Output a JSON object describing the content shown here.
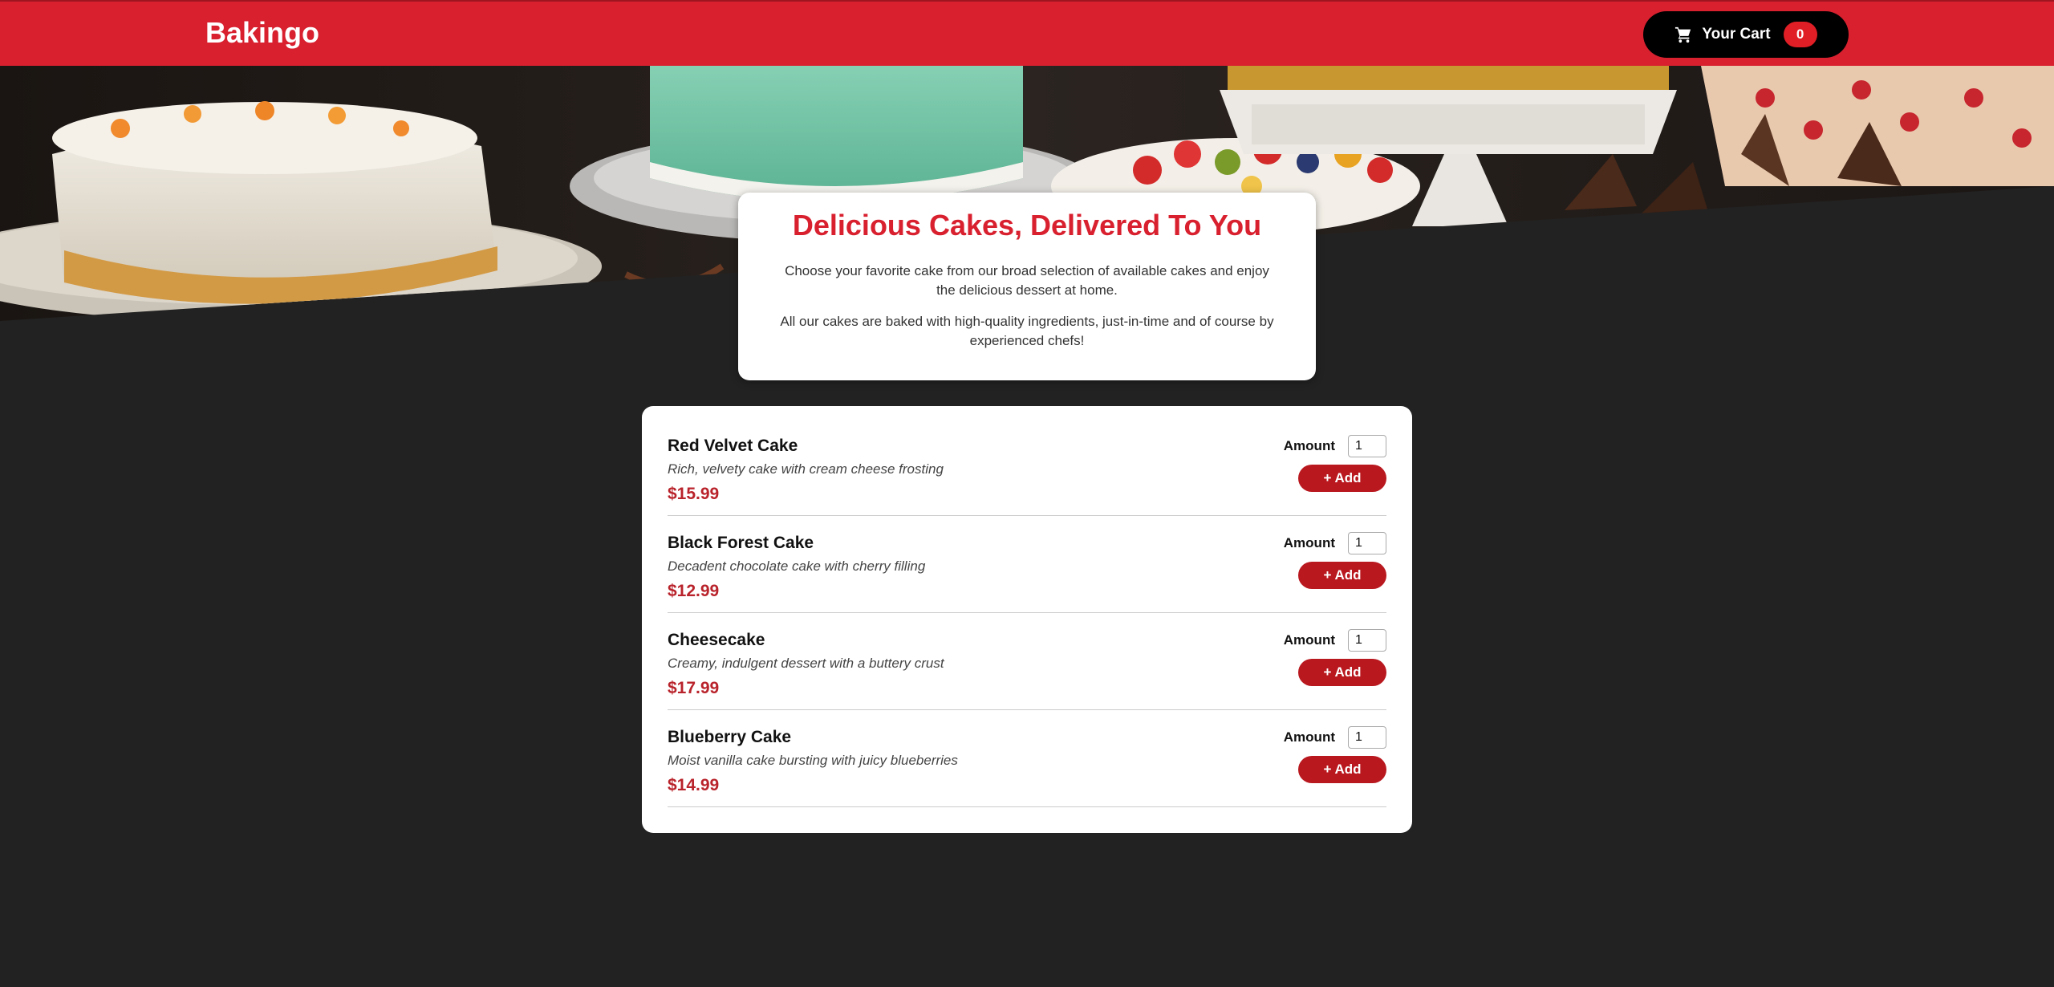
{
  "header": {
    "brand": "Bakingo",
    "cart": {
      "icon": "cart-icon",
      "label": "Your Cart",
      "count": "0"
    }
  },
  "hero": {
    "image_description_icon": "cakes-banner-image"
  },
  "summary": {
    "title": "Delicious Cakes, Delivered To You",
    "paragraph1": "Choose your favorite cake from our broad selection of available cakes and enjoy the delicious dessert at home.",
    "paragraph2": "All our cakes are baked with high-quality ingredients, just-in-time and of course by experienced chefs!"
  },
  "meals": [
    {
      "name": "Red Velvet Cake",
      "description": "Rich, velvety cake with cream cheese frosting",
      "price": "$15.99",
      "amount_label": "Amount",
      "amount": "1",
      "add_label": "+ Add"
    },
    {
      "name": "Black Forest Cake",
      "description": "Decadent chocolate cake with cherry filling",
      "price": "$12.99",
      "amount_label": "Amount",
      "amount": "1",
      "add_label": "+ Add"
    },
    {
      "name": "Cheesecake",
      "description": "Creamy, indulgent dessert with a buttery crust",
      "price": "$17.99",
      "amount_label": "Amount",
      "amount": "1",
      "add_label": "+ Add"
    },
    {
      "name": "Blueberry Cake",
      "description": "Moist vanilla cake bursting with juicy blueberries",
      "price": "$14.99",
      "amount_label": "Amount",
      "amount": "1",
      "add_label": "+ Add"
    }
  ],
  "colors": {
    "brand_red": "#d8202f",
    "price_red": "#b9232b",
    "button_red": "#b9181f",
    "background": "#222222"
  }
}
